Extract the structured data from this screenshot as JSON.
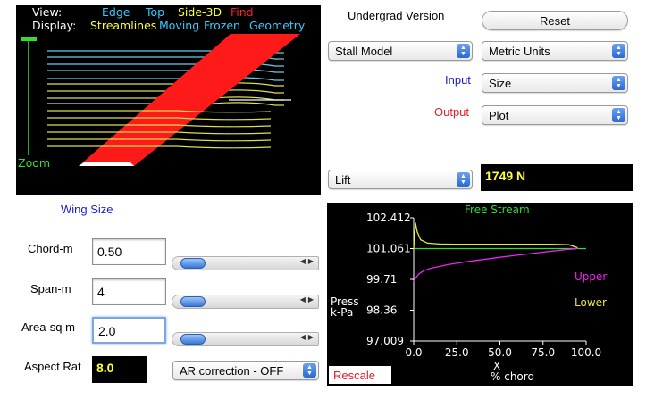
{
  "view_panel": {
    "view_label": "View:",
    "view_options": [
      "Edge",
      "Top",
      "Side-3D",
      "Find"
    ],
    "display_label": "Display:",
    "display_options": [
      "Streamlines",
      "Moving",
      "Frozen",
      "Geometry"
    ],
    "zoom_label": "Zoom"
  },
  "header": {
    "version_label": "Undergrad Version",
    "reset_label": "Reset"
  },
  "controls": {
    "model_select": "Stall Model",
    "units_select": "Metric Units",
    "input_label": "Input",
    "input_select": "Size",
    "output_label": "Output",
    "output_select": "Plot",
    "result_select": "Lift",
    "result_value": "1749 N"
  },
  "wing_size": {
    "title": "Wing Size",
    "chord_label": "Chord-m",
    "chord_value": "0.50",
    "chord_slider": 0.05,
    "span_label": "Span-m",
    "span_value": "4",
    "span_slider": 0.05,
    "area_label": "Area-sq m",
    "area_value": "2.0",
    "area_slider": 0.05,
    "aspect_label": "Aspect Rat",
    "aspect_value": "8.0",
    "ar_select": "AR correction - OFF"
  },
  "plot_panel": {
    "free_stream_label": "Free Stream",
    "ylabel_line1": "Press",
    "ylabel_line2": "k-Pa",
    "xlabel_line1": "X",
    "xlabel_line2": "% chord",
    "upper_label": "Upper",
    "lower_label": "Lower",
    "rescale_label": "Rescale",
    "colors": {
      "upper": "#ee22ee",
      "lower": "#e8e83a",
      "free_stream": "#33dd33"
    }
  },
  "chart_data": {
    "type": "line",
    "xlabel": "X % chord",
    "ylabel": "Press k-Pa",
    "x_ticks": [
      "0.0",
      "25.0",
      "50.0",
      "75.0",
      "100.0"
    ],
    "y_ticks": [
      "102.412",
      "101.061",
      "99.71",
      "98.36",
      "97.009"
    ],
    "xlim": [
      0,
      100
    ],
    "ylim": [
      97.009,
      102.412
    ],
    "free_stream": 101.061,
    "series": [
      {
        "name": "Upper",
        "x": [
          0,
          1,
          3,
          6,
          10,
          20,
          30,
          40,
          50,
          60,
          70,
          80,
          90,
          95
        ],
        "values": [
          99.6,
          99.75,
          99.95,
          100.1,
          100.2,
          100.36,
          100.48,
          100.58,
          100.68,
          100.77,
          100.86,
          100.95,
          101.03,
          101.06
        ]
      },
      {
        "name": "Lower",
        "x": [
          0,
          1,
          2,
          4,
          8,
          15,
          25,
          40,
          60,
          80,
          90,
          95
        ],
        "values": [
          101.06,
          102.2,
          101.8,
          101.45,
          101.3,
          101.26,
          101.25,
          101.25,
          101.25,
          101.25,
          101.23,
          101.1
        ]
      }
    ]
  }
}
